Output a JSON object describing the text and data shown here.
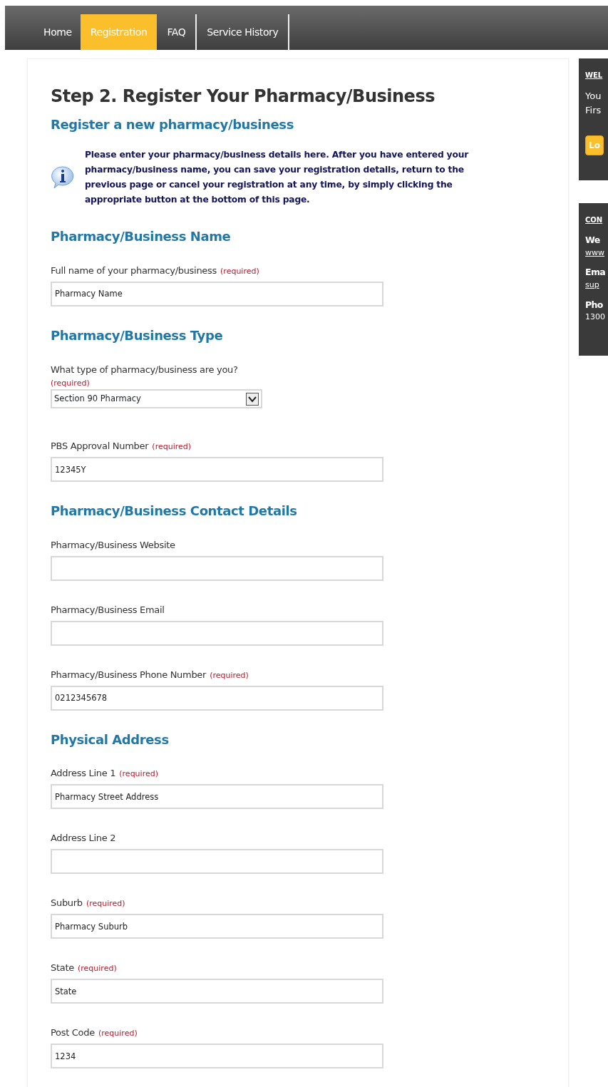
{
  "nav": [
    {
      "label": "Home",
      "selected": false
    },
    {
      "label": "Registration",
      "selected": true
    },
    {
      "label": "FAQ",
      "selected": false
    },
    {
      "label": "Service History",
      "selected": false
    }
  ],
  "page_title": "Step 2. Register Your Pharmacy/Business",
  "subtitle": "Register a new pharmacy/business",
  "info_text": "Please enter your pharmacy/business details here. After you have entered your pharmacy/business name, you can save your registration details, return to the previous page or cancel your registration at any time, by simply clicking the appropriate button at the bottom of this page.",
  "sections": [
    {
      "heading": "Pharmacy/Business Name",
      "fields": [
        {
          "kind": "text",
          "label": "Full name of your pharmacy/business",
          "note": "(required)",
          "value": "Pharmacy Name"
        }
      ]
    },
    {
      "heading": "Pharmacy/Business Type",
      "fields": [
        {
          "kind": "select",
          "label": "What type of pharmacy/business are you?",
          "note": "(required)",
          "value": "Section 90 Pharmacy"
        },
        {
          "kind": "text",
          "label": "PBS Approval Number",
          "note": "(required)",
          "value": "12345Y"
        }
      ]
    },
    {
      "heading": "Pharmacy/Business Contact Details",
      "fields": [
        {
          "kind": "text",
          "label": "Pharmacy/Business Website"
        },
        {
          "kind": "text",
          "label": "Pharmacy/Business Email"
        },
        {
          "kind": "text",
          "label": "Pharmacy/Business Phone Number",
          "note": "(required)",
          "value": "0212345678"
        }
      ]
    },
    {
      "heading": "Physical Address",
      "fields": [
        {
          "kind": "text",
          "label": "Address Line 1",
          "note": "(required)",
          "value": "Pharmacy Street Address"
        },
        {
          "kind": "text",
          "label": "Address Line 2"
        },
        {
          "kind": "text",
          "label": "Suburb",
          "note": "(required)",
          "value": "Pharmacy Suburb"
        },
        {
          "kind": "text",
          "label": "State",
          "note": "(required)",
          "value": "State"
        },
        {
          "kind": "text",
          "label": "Post Code",
          "note": "(required)",
          "value": "1234"
        }
      ]
    }
  ],
  "side_panels": [
    {
      "heading": "WEL",
      "lines": [
        "You",
        "Firs"
      ],
      "button": "Lo"
    },
    {
      "heading": "CON",
      "items": [
        {
          "title": "We",
          "value": "www",
          "link": true
        },
        {
          "title": "Ema",
          "value": "sup",
          "link": true
        },
        {
          "title": "Pho",
          "value": "1300",
          "link": false
        }
      ]
    }
  ]
}
